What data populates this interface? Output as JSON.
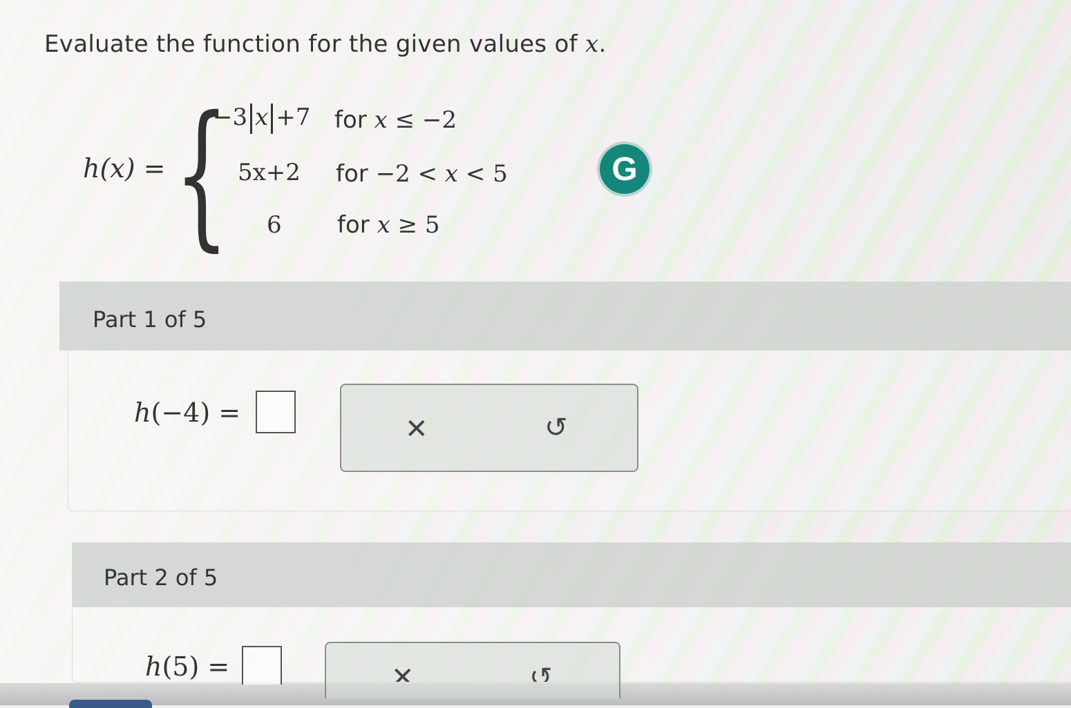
{
  "instruction": {
    "text": "Evaluate the function for the given values of ",
    "var": "x",
    "end": "."
  },
  "function": {
    "label": "h(x) =",
    "pieces": [
      {
        "expr_pre": "−3",
        "expr_abs": "x",
        "expr_post": "+7",
        "cond_word": "for",
        "cond_var": "x",
        "cond_rest": "≤ −2"
      },
      {
        "expr": "5x+2",
        "cond_word": "for",
        "cond_pre": "−2 <",
        "cond_var": "x",
        "cond_rest": "< 5"
      },
      {
        "expr": "6",
        "cond_word": "for",
        "cond_var": "x",
        "cond_rest": "≥ 5"
      }
    ]
  },
  "grammarly_icon": {
    "glyph": "G",
    "color": "#14867a"
  },
  "parts": [
    {
      "title": "Part 1 of 5",
      "lhs_fn": "h",
      "lhs_arg": "(−4)",
      "equals": "=",
      "clear_icon": "✕",
      "undo_icon": "↺"
    },
    {
      "title": "Part 2 of 5",
      "lhs_fn": "h",
      "lhs_arg": "(5)",
      "equals": "=",
      "clear_icon": "✕",
      "undo_icon": "↺"
    }
  ]
}
